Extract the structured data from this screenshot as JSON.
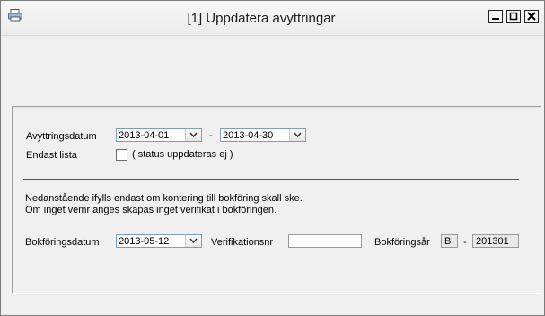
{
  "window": {
    "title": "[1]  Uppdatera avyttringar",
    "icon": "printer-icon"
  },
  "form": {
    "avyttringsdatum_label": "Avyttringsdatum",
    "date_from": "2013-04-01",
    "range_separator": "-",
    "date_to": "2013-04-30",
    "endast_lista_label": "Endast lista",
    "endast_lista_checked": false,
    "endast_lista_note": "( status uppdateras ej )",
    "info_line1": "Nedanstående ifylls endast om kontering till bokföring skall ske.",
    "info_line2": "Om inget vemr anges skapas inget verifikat i bokföringen.",
    "bokforingsdatum_label": "Bokföringsdatum",
    "bokforingsdatum": "2013-05-12",
    "verifikationsnr_label": "Verifikationsnr",
    "verifikationsnr": "",
    "bokforingsar_label": "Bokföringsår",
    "bokforingsar_serie": "B",
    "bokforingsar_dash": "-",
    "bokforingsar": "201301"
  }
}
